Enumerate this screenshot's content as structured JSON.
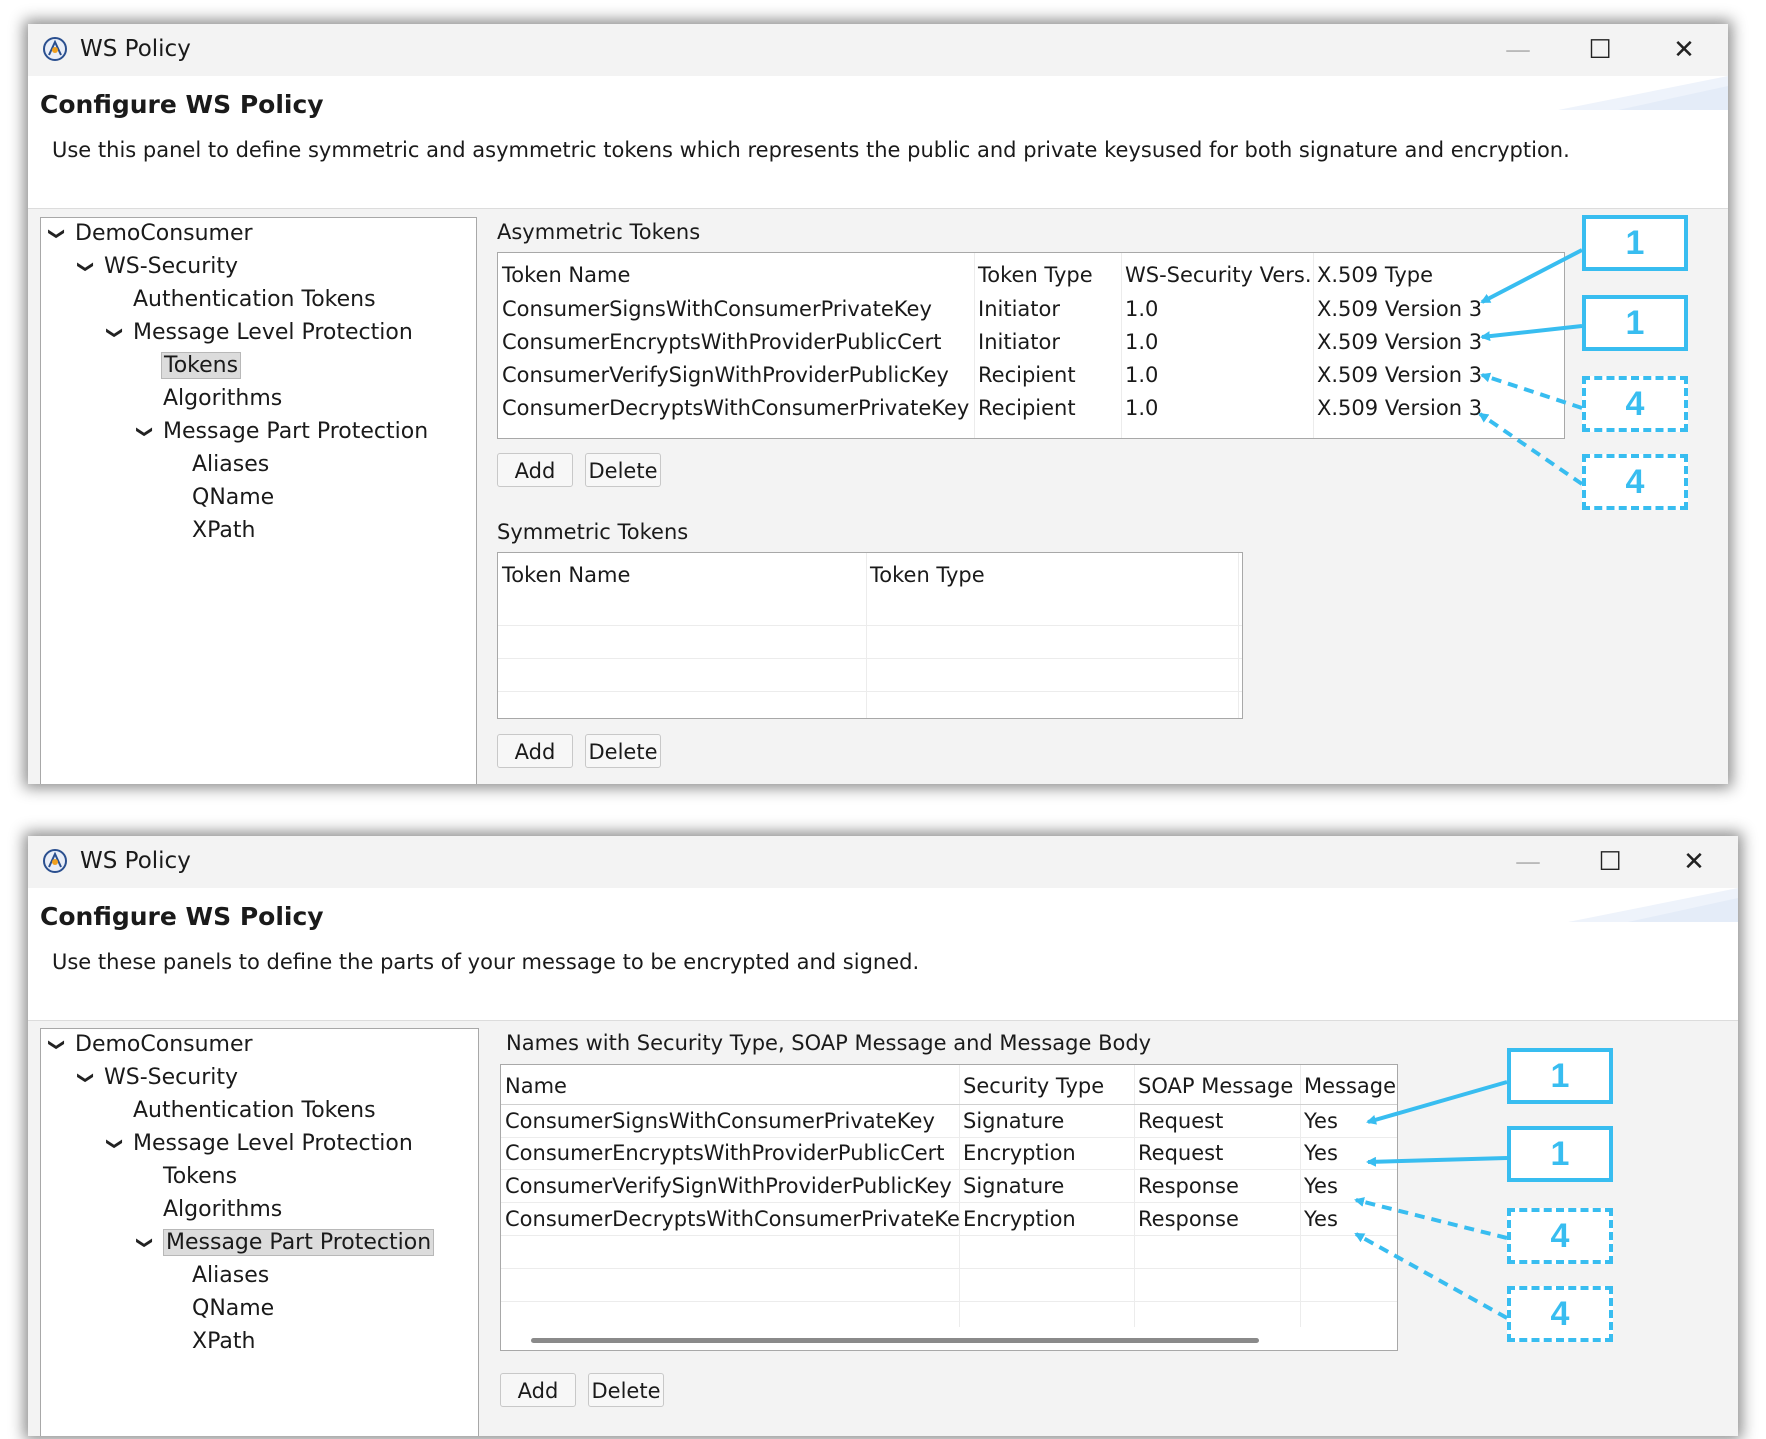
{
  "window_top": {
    "title": "WS Policy",
    "header_title": "Configure WS Policy",
    "header_desc": "Use this panel to define symmetric and asymmetric tokens which represents the public and private keysused for both signature and encryption.",
    "tree": [
      "DemoConsumer",
      "WS-Security",
      "Authentication Tokens",
      "Message Level Protection",
      "Tokens",
      "Algorithms",
      "Message Part Protection",
      "Aliases",
      "QName",
      "XPath"
    ],
    "asym_label": "Asymmetric Tokens",
    "asym_headers": [
      "Token Name",
      "Token Type",
      "WS-Security Vers...",
      "X.509 Type"
    ],
    "asym_rows": [
      [
        "ConsumerSignsWithConsumerPrivateKey",
        "Initiator",
        "1.0",
        "X.509 Version 3"
      ],
      [
        "ConsumerEncryptsWithProviderPublicCert",
        "Initiator",
        "1.0",
        "X.509 Version 3"
      ],
      [
        "ConsumerVerifySignWithProviderPublicKey",
        "Recipient",
        "1.0",
        "X.509 Version 3"
      ],
      [
        "ConsumerDecryptsWithConsumerPrivateKey",
        "Recipient",
        "1.0",
        "X.509 Version 3"
      ]
    ],
    "sym_label": "Symmetric Tokens",
    "sym_headers": [
      "Token Name",
      "Token Type"
    ],
    "add_label": "Add",
    "delete_label": "Delete",
    "callouts": [
      "1",
      "1",
      "4",
      "4"
    ]
  },
  "window_bottom": {
    "title": "WS Policy",
    "header_title": "Configure WS Policy",
    "header_desc": "Use these panels to define the parts of your message to be encrypted and signed.",
    "tree": [
      "DemoConsumer",
      "WS-Security",
      "Authentication Tokens",
      "Message Level Protection",
      "Tokens",
      "Algorithms",
      "Message Part Protection",
      "Aliases",
      "QName",
      "XPath"
    ],
    "table_label": "Names with Security Type, SOAP Message and Message Body",
    "headers": [
      "Name",
      "Security Type",
      "SOAP Message",
      "Message"
    ],
    "rows": [
      [
        "ConsumerSignsWithConsumerPrivateKey",
        "Signature",
        "Request",
        "Yes"
      ],
      [
        "ConsumerEncryptsWithProviderPublicCert",
        "Encryption",
        "Request",
        "Yes"
      ],
      [
        "ConsumerVerifySignWithProviderPublicKey",
        "Signature",
        "Response",
        "Yes"
      ],
      [
        "ConsumerDecryptsWithConsumerPrivateKey",
        "Encryption",
        "Response",
        "Yes"
      ]
    ],
    "add_label": "Add",
    "delete_label": "Delete",
    "callouts": [
      "1",
      "1",
      "4",
      "4"
    ]
  },
  "colors": {
    "callout": "#38bdf0",
    "selection": "#dcdcdc",
    "window_bg": "#f3f3f3"
  },
  "icons": {
    "app": "eclipse-icon",
    "minimize": "minimize-icon",
    "maximize": "maximize-icon",
    "close": "close-icon",
    "expand": "chevron-down-icon"
  }
}
